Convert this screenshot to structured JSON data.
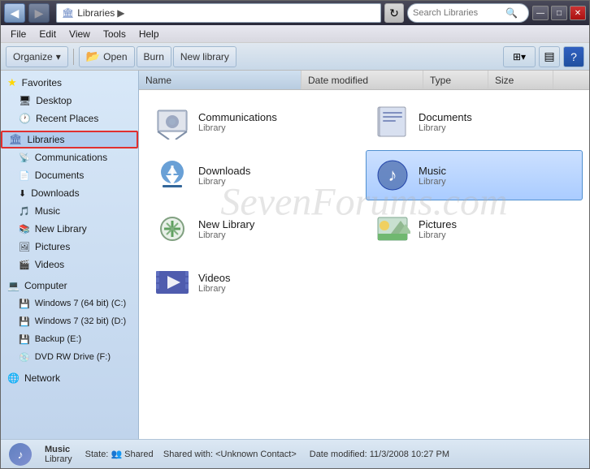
{
  "window": {
    "title": "Libraries"
  },
  "titlebar": {
    "minimize": "—",
    "maximize": "□",
    "close": "✕"
  },
  "addressbar": {
    "back_title": "Back",
    "forward_title": "Forward",
    "path_icon": "🏛",
    "path_label": "Libraries",
    "path_arrow": "▶",
    "refresh_icon": "↻",
    "search_placeholder": "Search Libraries"
  },
  "toolbar": {
    "organize_label": "Organize",
    "organize_arrow": "▾",
    "open_label": "Open",
    "burn_label": "Burn",
    "new_library_label": "New library",
    "help_icon": "?"
  },
  "columns": {
    "name": "Name",
    "date_modified": "Date modified",
    "type": "Type",
    "size": "Size"
  },
  "files": [
    {
      "name": "Communications",
      "type": "Library",
      "icon": "communications",
      "selected": false
    },
    {
      "name": "Documents",
      "type": "Library",
      "icon": "documents",
      "selected": false
    },
    {
      "name": "Downloads",
      "type": "Library",
      "icon": "downloads",
      "selected": false
    },
    {
      "name": "Music",
      "type": "Library",
      "icon": "music",
      "selected": true
    },
    {
      "name": "New Library",
      "type": "Library",
      "icon": "newlibrary",
      "selected": false
    },
    {
      "name": "Pictures",
      "type": "Library",
      "icon": "pictures",
      "selected": false
    },
    {
      "name": "Videos",
      "type": "Library",
      "icon": "videos",
      "selected": false
    }
  ],
  "sidebar": {
    "favorites_label": "Favorites",
    "desktop_label": "Desktop",
    "recent_places_label": "Recent Places",
    "libraries_label": "Libraries",
    "communications_label": "Communications",
    "documents_label": "Documents",
    "downloads_label": "Downloads",
    "music_label": "Music",
    "new_library_label": "New Library",
    "pictures_label": "Pictures",
    "videos_label": "Videos",
    "computer_label": "Computer",
    "win7_64_label": "Windows 7 (64 bit) (C:)",
    "win7_32_label": "Windows 7 (32 bit) (D:)",
    "backup_label": "Backup (E:)",
    "dvd_label": "DVD RW Drive (F:)",
    "network_label": "Network"
  },
  "statusbar": {
    "item_name": "Music",
    "item_sub": "Library",
    "state_label": "State:",
    "state_value": "Shared",
    "shared_label": "Shared with:",
    "shared_value": "<Unknown Contact>",
    "date_label": "Date modified:",
    "date_value": "11/3/2008 10:27 PM"
  },
  "watermark": "SevenForums.com"
}
